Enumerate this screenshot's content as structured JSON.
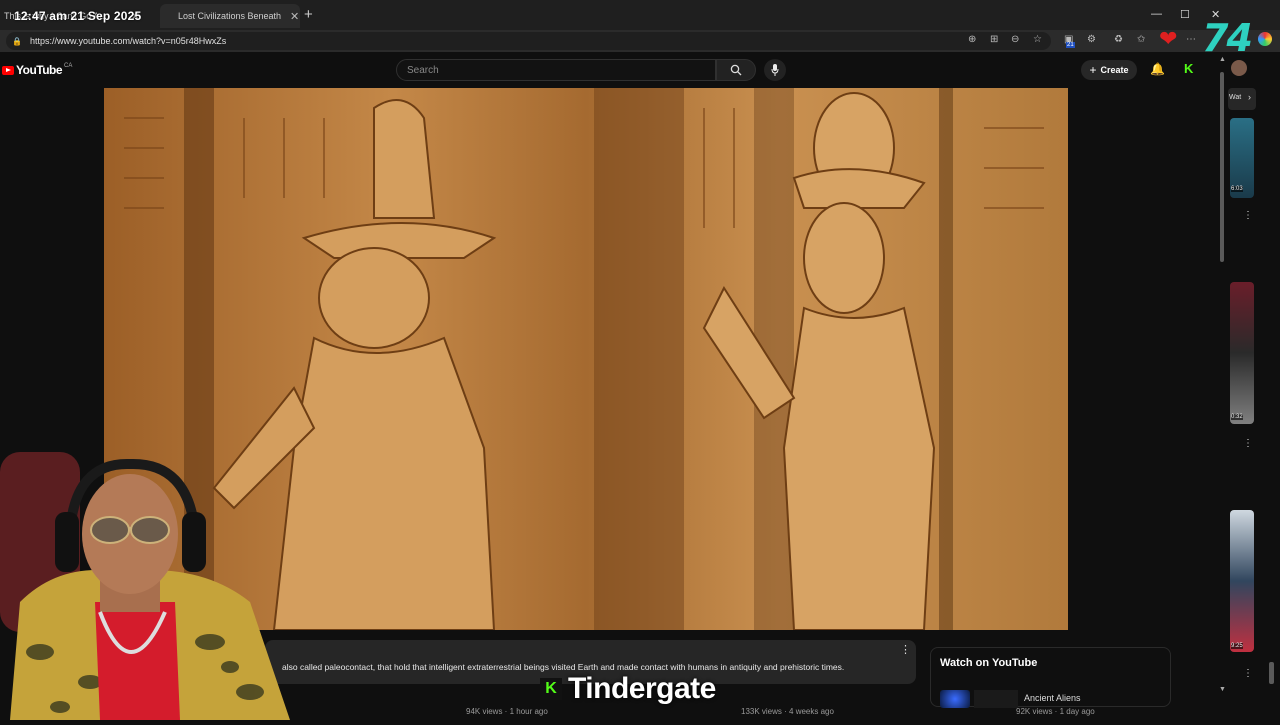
{
  "browser": {
    "clock": "12:47 am 21 Sep 2025",
    "tabs": [
      {
        "label": "This is why I Can't Go Ar..."
      },
      {
        "label": "Lost Civilizations Beneath An"
      }
    ],
    "url": "https://www.youtube.com/watch?v=n05r48HwxZs",
    "notification_count": "21",
    "overlay_number": "74"
  },
  "youtube": {
    "logo_text": "YouTube",
    "country_code": "CA",
    "search_placeholder": "Search",
    "create_label": "Create"
  },
  "description": {
    "text": "also called paleocontact, that hold that intelligent extraterrestrial beings visited Earth and made contact with humans in antiquity and prehistoric times."
  },
  "watch_panel": {
    "title": "Watch on YouTube",
    "item": "Ancient Aliens"
  },
  "meta": [
    "94K views · 1 hour ago",
    "133K views · 4 weeks ago",
    "92K views · 1 day ago"
  ],
  "rail": {
    "durations": [
      "6:03",
      "0:32",
      "9:25"
    ],
    "label_top": "Wat"
  },
  "streamer": {
    "name": "Tindergate",
    "platform_icon": "kick-icon"
  },
  "colors": {
    "brand_red": "#ff0000",
    "kick_green": "#53fc18",
    "overlay_teal": "#2ed1c0"
  }
}
